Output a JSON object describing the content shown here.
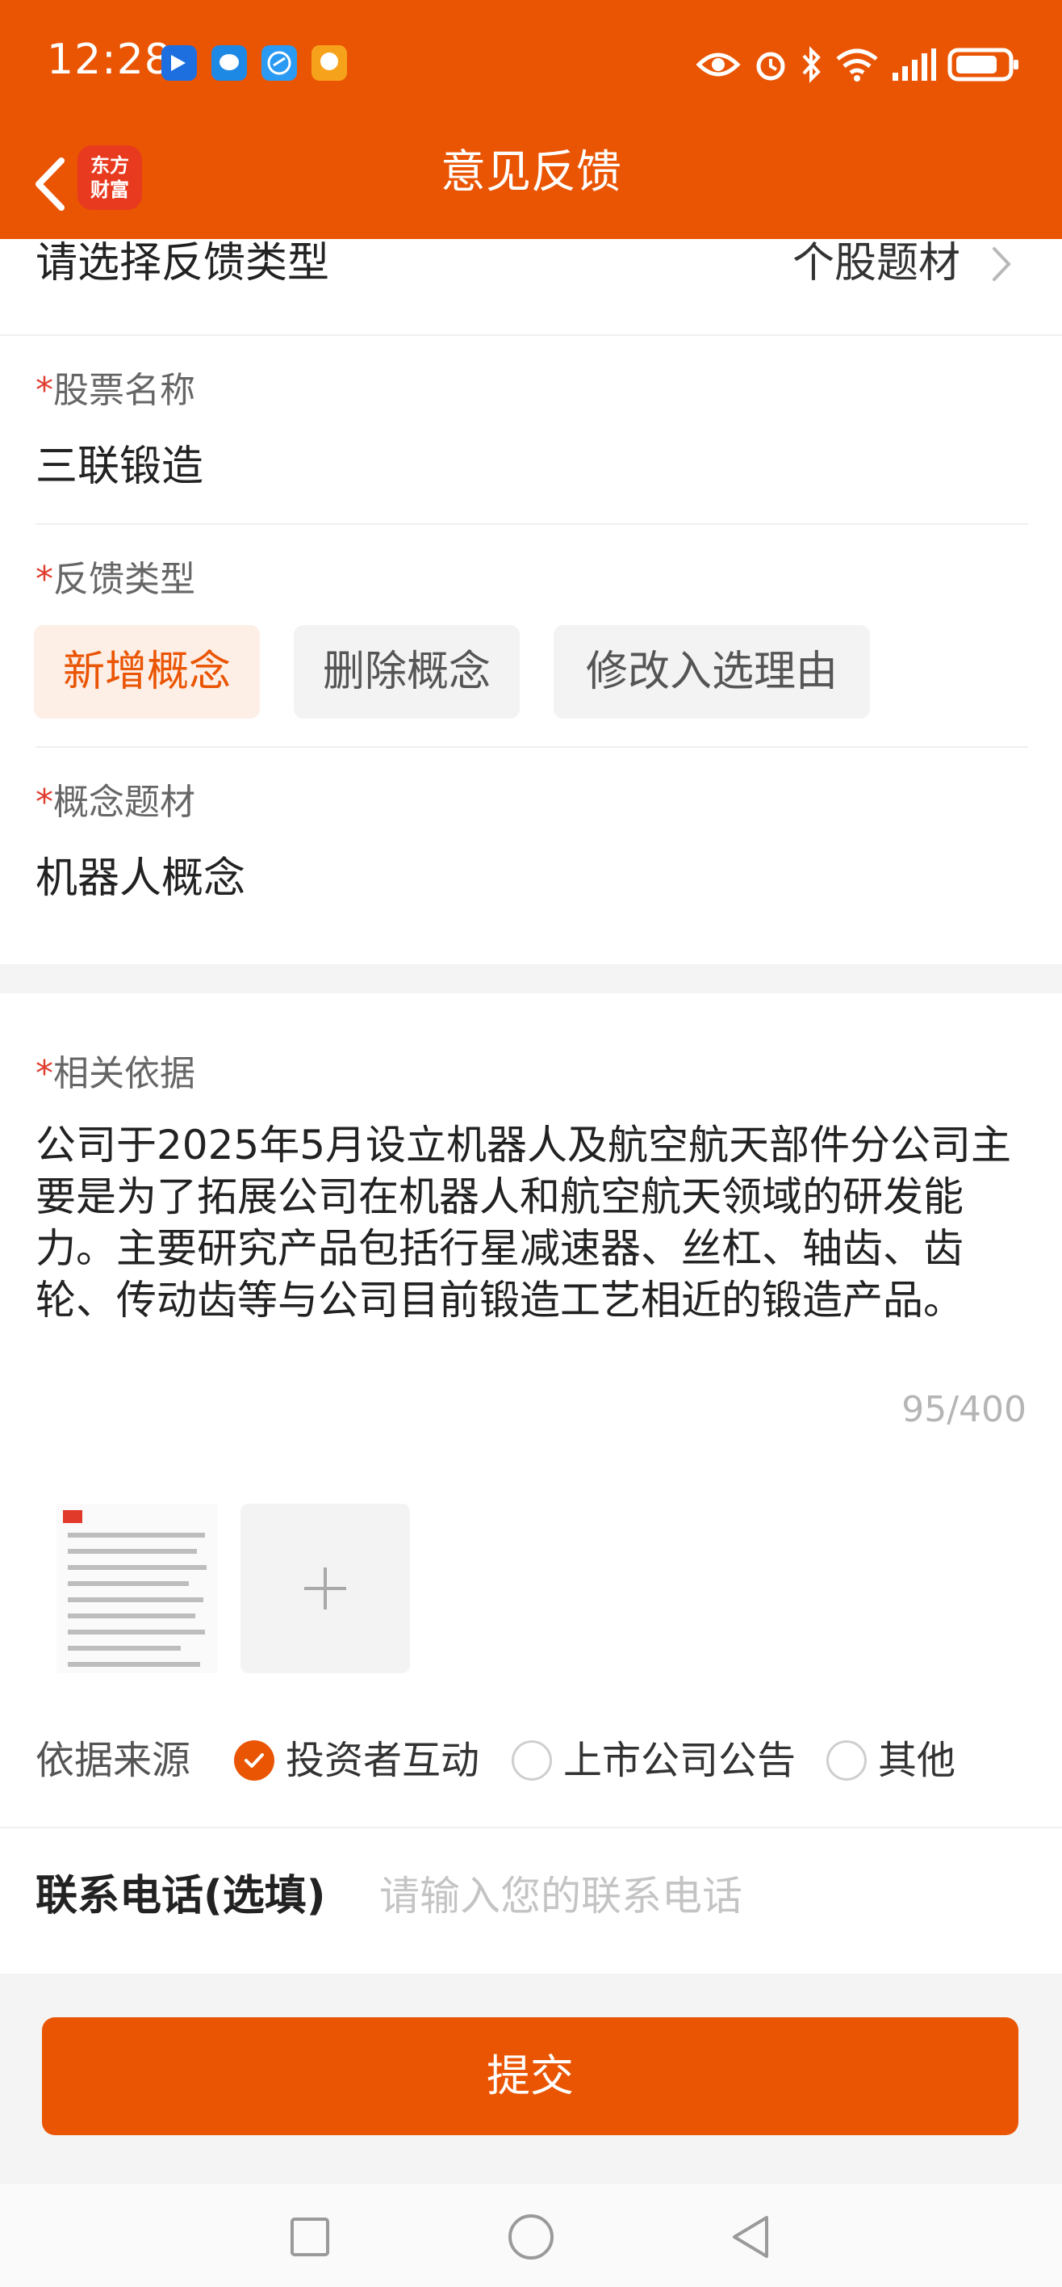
{
  "status_bar": {
    "time": "12:28",
    "notification_icons": [
      "bird-app-icon",
      "chat-bubble-icon",
      "browser-icon",
      "game-app-icon"
    ],
    "right_icons": [
      "eye-icon",
      "alarm-icon",
      "bluetooth-icon",
      "wifi-icon",
      "signal-icon",
      "battery-icon"
    ]
  },
  "header": {
    "title": "意见反馈",
    "logo_line1": "东方",
    "logo_line2": "财富",
    "bg_color": "#ea5504"
  },
  "form": {
    "feedback_type_row": {
      "label": "请选择反馈类型",
      "value": "个股题材"
    },
    "stock_name": {
      "required": "*",
      "label": "股票名称",
      "value": "三联锻造"
    },
    "feedback_kind": {
      "required": "*",
      "label": "反馈类型",
      "options": [
        "新增概念",
        "删除概念",
        "修改入选理由"
      ],
      "selected": "新增概念"
    },
    "concept": {
      "required": "*",
      "label": "概念题材",
      "value": "机器人概念"
    },
    "basis": {
      "required": "*",
      "label": "相关依据",
      "text": "公司于2025年5月设立机器人及航空航天部件分公司主要是为了拓展公司在机器人和航空航天领域的研发能力。主要研究产品包括行星减速器、丝杠、轴齿、齿轮、传动齿等与公司目前锻造工艺相近的锻造产品。",
      "counter": "95/400"
    },
    "source": {
      "label": "依据来源",
      "options": [
        "投资者互动",
        "上市公司公告",
        "其他"
      ],
      "selected": "投资者互动"
    },
    "phone": {
      "label": "联系电话(选填)",
      "placeholder": "请输入您的联系电话",
      "value": ""
    }
  },
  "actions": {
    "submit_label": "提交",
    "accent_color": "#ea5504"
  },
  "system_nav": [
    "recent-apps-icon",
    "home-icon",
    "back-triangle-icon"
  ]
}
